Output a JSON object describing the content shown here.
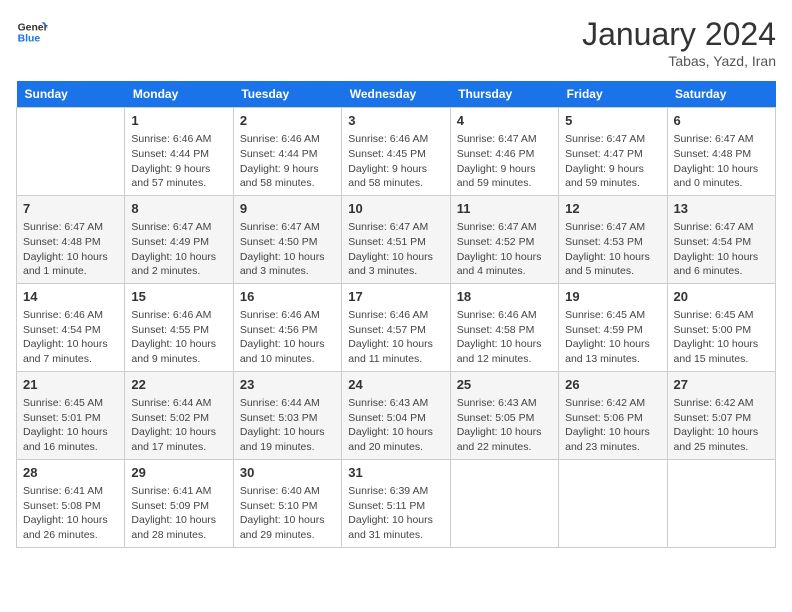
{
  "header": {
    "logo_line1": "General",
    "logo_line2": "Blue",
    "title": "January 2024",
    "subtitle": "Tabas, Yazd, Iran"
  },
  "days_of_week": [
    "Sunday",
    "Monday",
    "Tuesday",
    "Wednesday",
    "Thursday",
    "Friday",
    "Saturday"
  ],
  "weeks": [
    [
      {
        "day": "",
        "info": ""
      },
      {
        "day": "1",
        "info": "Sunrise: 6:46 AM\nSunset: 4:44 PM\nDaylight: 9 hours\nand 57 minutes."
      },
      {
        "day": "2",
        "info": "Sunrise: 6:46 AM\nSunset: 4:44 PM\nDaylight: 9 hours\nand 58 minutes."
      },
      {
        "day": "3",
        "info": "Sunrise: 6:46 AM\nSunset: 4:45 PM\nDaylight: 9 hours\nand 58 minutes."
      },
      {
        "day": "4",
        "info": "Sunrise: 6:47 AM\nSunset: 4:46 PM\nDaylight: 9 hours\nand 59 minutes."
      },
      {
        "day": "5",
        "info": "Sunrise: 6:47 AM\nSunset: 4:47 PM\nDaylight: 9 hours\nand 59 minutes."
      },
      {
        "day": "6",
        "info": "Sunrise: 6:47 AM\nSunset: 4:48 PM\nDaylight: 10 hours\nand 0 minutes."
      }
    ],
    [
      {
        "day": "7",
        "info": "Sunrise: 6:47 AM\nSunset: 4:48 PM\nDaylight: 10 hours\nand 1 minute."
      },
      {
        "day": "8",
        "info": "Sunrise: 6:47 AM\nSunset: 4:49 PM\nDaylight: 10 hours\nand 2 minutes."
      },
      {
        "day": "9",
        "info": "Sunrise: 6:47 AM\nSunset: 4:50 PM\nDaylight: 10 hours\nand 3 minutes."
      },
      {
        "day": "10",
        "info": "Sunrise: 6:47 AM\nSunset: 4:51 PM\nDaylight: 10 hours\nand 3 minutes."
      },
      {
        "day": "11",
        "info": "Sunrise: 6:47 AM\nSunset: 4:52 PM\nDaylight: 10 hours\nand 4 minutes."
      },
      {
        "day": "12",
        "info": "Sunrise: 6:47 AM\nSunset: 4:53 PM\nDaylight: 10 hours\nand 5 minutes."
      },
      {
        "day": "13",
        "info": "Sunrise: 6:47 AM\nSunset: 4:54 PM\nDaylight: 10 hours\nand 6 minutes."
      }
    ],
    [
      {
        "day": "14",
        "info": "Sunrise: 6:46 AM\nSunset: 4:54 PM\nDaylight: 10 hours\nand 7 minutes."
      },
      {
        "day": "15",
        "info": "Sunrise: 6:46 AM\nSunset: 4:55 PM\nDaylight: 10 hours\nand 9 minutes."
      },
      {
        "day": "16",
        "info": "Sunrise: 6:46 AM\nSunset: 4:56 PM\nDaylight: 10 hours\nand 10 minutes."
      },
      {
        "day": "17",
        "info": "Sunrise: 6:46 AM\nSunset: 4:57 PM\nDaylight: 10 hours\nand 11 minutes."
      },
      {
        "day": "18",
        "info": "Sunrise: 6:46 AM\nSunset: 4:58 PM\nDaylight: 10 hours\nand 12 minutes."
      },
      {
        "day": "19",
        "info": "Sunrise: 6:45 AM\nSunset: 4:59 PM\nDaylight: 10 hours\nand 13 minutes."
      },
      {
        "day": "20",
        "info": "Sunrise: 6:45 AM\nSunset: 5:00 PM\nDaylight: 10 hours\nand 15 minutes."
      }
    ],
    [
      {
        "day": "21",
        "info": "Sunrise: 6:45 AM\nSunset: 5:01 PM\nDaylight: 10 hours\nand 16 minutes."
      },
      {
        "day": "22",
        "info": "Sunrise: 6:44 AM\nSunset: 5:02 PM\nDaylight: 10 hours\nand 17 minutes."
      },
      {
        "day": "23",
        "info": "Sunrise: 6:44 AM\nSunset: 5:03 PM\nDaylight: 10 hours\nand 19 minutes."
      },
      {
        "day": "24",
        "info": "Sunrise: 6:43 AM\nSunset: 5:04 PM\nDaylight: 10 hours\nand 20 minutes."
      },
      {
        "day": "25",
        "info": "Sunrise: 6:43 AM\nSunset: 5:05 PM\nDaylight: 10 hours\nand 22 minutes."
      },
      {
        "day": "26",
        "info": "Sunrise: 6:42 AM\nSunset: 5:06 PM\nDaylight: 10 hours\nand 23 minutes."
      },
      {
        "day": "27",
        "info": "Sunrise: 6:42 AM\nSunset: 5:07 PM\nDaylight: 10 hours\nand 25 minutes."
      }
    ],
    [
      {
        "day": "28",
        "info": "Sunrise: 6:41 AM\nSunset: 5:08 PM\nDaylight: 10 hours\nand 26 minutes."
      },
      {
        "day": "29",
        "info": "Sunrise: 6:41 AM\nSunset: 5:09 PM\nDaylight: 10 hours\nand 28 minutes."
      },
      {
        "day": "30",
        "info": "Sunrise: 6:40 AM\nSunset: 5:10 PM\nDaylight: 10 hours\nand 29 minutes."
      },
      {
        "day": "31",
        "info": "Sunrise: 6:39 AM\nSunset: 5:11 PM\nDaylight: 10 hours\nand 31 minutes."
      },
      {
        "day": "",
        "info": ""
      },
      {
        "day": "",
        "info": ""
      },
      {
        "day": "",
        "info": ""
      }
    ]
  ]
}
